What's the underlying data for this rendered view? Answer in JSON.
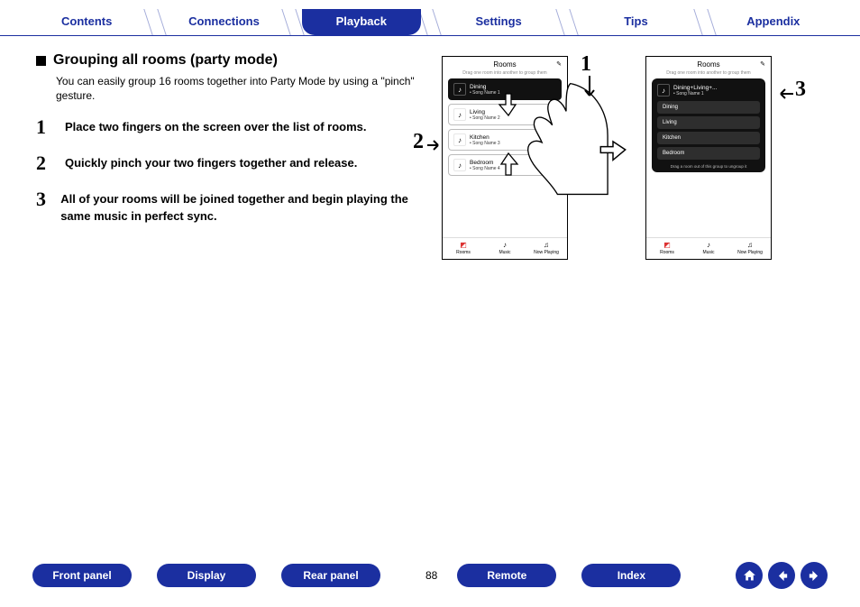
{
  "topnav": {
    "tabs": [
      "Contents",
      "Connections",
      "Playback",
      "Settings",
      "Tips",
      "Appendix"
    ],
    "active_index": 2
  },
  "section": {
    "heading": "Grouping all rooms (party mode)",
    "intro": "You can easily group 16 rooms together into Party Mode by using a \"pinch\" gesture.",
    "steps": [
      "Place two fingers on the screen over the list of rooms.",
      "Quickly pinch your two fingers together and release.",
      "All of your rooms will be joined together and begin playing the same music in perfect sync."
    ]
  },
  "phone_left": {
    "title": "Rooms",
    "subtitle": "Drag one room into another to group them",
    "rooms": [
      {
        "name": "Dining",
        "song": "Song Name 1",
        "dark": true
      },
      {
        "name": "Living",
        "song": "Song Name 2"
      },
      {
        "name": "Kitchen",
        "song": "Song Name 3"
      },
      {
        "name": "Bedroom",
        "song": "Song Name 4"
      }
    ],
    "bottom": [
      "Rooms",
      "Music",
      "Now Playing"
    ]
  },
  "phone_right": {
    "title": "Rooms",
    "subtitle": "Drag one room into another to group them",
    "group_header": {
      "name": "Dining+Living+...",
      "song": "Song Name 1"
    },
    "group_items": [
      "Dining",
      "Living",
      "Kitchen",
      "Bedroom"
    ],
    "group_footer": "Drag a room out of this group to ungroup it",
    "bottom": [
      "Rooms",
      "Music",
      "Now Playing"
    ]
  },
  "annotations": {
    "a1": "1",
    "a2": "2",
    "a3": "3"
  },
  "footer": {
    "buttons": [
      "Front panel",
      "Display",
      "Rear panel",
      "Remote",
      "Index"
    ],
    "page": "88"
  }
}
